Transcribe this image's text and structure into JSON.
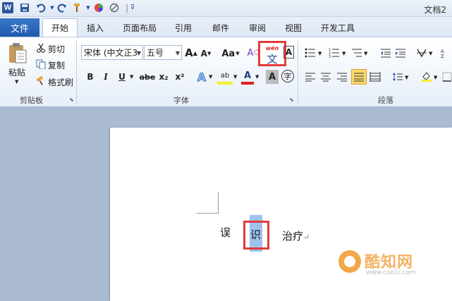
{
  "app": {
    "logo": "W",
    "title": "文档2"
  },
  "quick_access": {
    "icons": [
      "save-icon",
      "undo-icon",
      "redo-icon",
      "format-painter-icon",
      "color-icon",
      "no-draw-icon",
      "customize-icon"
    ]
  },
  "tabs": [
    {
      "label": "文件"
    },
    {
      "label": "开始"
    },
    {
      "label": "插入"
    },
    {
      "label": "页面布局"
    },
    {
      "label": "引用"
    },
    {
      "label": "邮件"
    },
    {
      "label": "审阅"
    },
    {
      "label": "视图"
    },
    {
      "label": "开发工具"
    }
  ],
  "clipboard": {
    "paste_label": "粘贴",
    "cut_label": "剪切",
    "copy_label": "复制",
    "format_painter_label": "格式刷",
    "group_label": "剪贴板"
  },
  "font": {
    "font_name": "宋体 (中文正3",
    "font_size": "五号",
    "grow": "A",
    "shrink": "A",
    "change_case": "Aa",
    "clear_format": "A",
    "phonetic_top": "wén",
    "phonetic_char": "文",
    "char_border": "A",
    "bold": "B",
    "italic": "I",
    "underline": "U",
    "strike": "abe",
    "subscript": "x₂",
    "superscript": "x²",
    "text_effect": "A",
    "highlight": "ab",
    "font_color": "A",
    "char_shading": "A",
    "enclose": "字",
    "group_label": "字体"
  },
  "paragraph": {
    "group_label": "段落"
  },
  "document": {
    "char_1": "误",
    "char_selected": "识",
    "text_after": "治疗",
    "paragraph_mark": "↵"
  },
  "watermark": {
    "text": "酷知网",
    "url": "www.coo1i.com"
  }
}
